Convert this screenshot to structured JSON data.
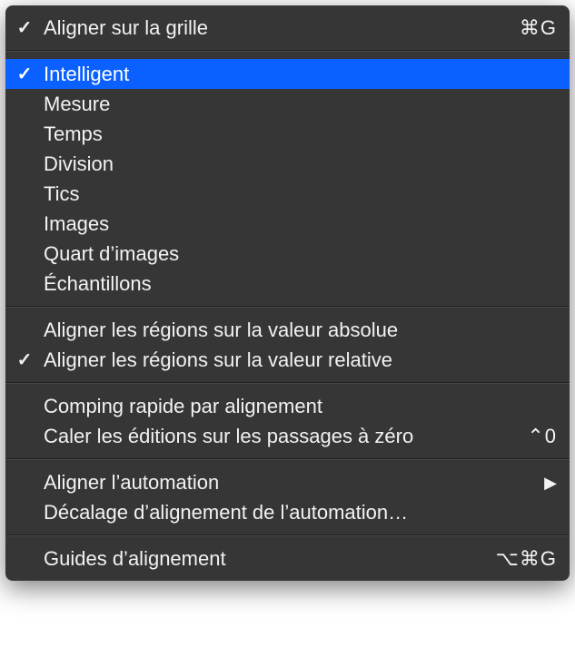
{
  "menu": {
    "groups": [
      {
        "items": [
          {
            "label": "Aligner sur la grille",
            "checked": true,
            "selected": false,
            "shortcut": "⌘G",
            "submenu": false,
            "name": "snap-to-grid"
          }
        ]
      },
      {
        "items": [
          {
            "label": "Intelligent",
            "checked": true,
            "selected": true,
            "shortcut": "",
            "submenu": false,
            "name": "snap-mode-smart"
          },
          {
            "label": "Mesure",
            "checked": false,
            "selected": false,
            "shortcut": "",
            "submenu": false,
            "name": "snap-mode-bar"
          },
          {
            "label": "Temps",
            "checked": false,
            "selected": false,
            "shortcut": "",
            "submenu": false,
            "name": "snap-mode-beat"
          },
          {
            "label": "Division",
            "checked": false,
            "selected": false,
            "shortcut": "",
            "submenu": false,
            "name": "snap-mode-division"
          },
          {
            "label": "Tics",
            "checked": false,
            "selected": false,
            "shortcut": "",
            "submenu": false,
            "name": "snap-mode-ticks"
          },
          {
            "label": "Images",
            "checked": false,
            "selected": false,
            "shortcut": "",
            "submenu": false,
            "name": "snap-mode-frames"
          },
          {
            "label": "Quart d’images",
            "checked": false,
            "selected": false,
            "shortcut": "",
            "submenu": false,
            "name": "snap-mode-quarter-frames"
          },
          {
            "label": "Échantillons",
            "checked": false,
            "selected": false,
            "shortcut": "",
            "submenu": false,
            "name": "snap-mode-samples"
          }
        ]
      },
      {
        "items": [
          {
            "label": "Aligner les régions sur la valeur absolue",
            "checked": false,
            "selected": false,
            "shortcut": "",
            "submenu": false,
            "name": "snap-regions-absolute"
          },
          {
            "label": "Aligner les régions sur la valeur relative",
            "checked": true,
            "selected": false,
            "shortcut": "",
            "submenu": false,
            "name": "snap-regions-relative"
          }
        ]
      },
      {
        "items": [
          {
            "label": "Comping rapide par alignement",
            "checked": false,
            "selected": false,
            "shortcut": "",
            "submenu": false,
            "name": "snap-quick-swipe-comping"
          },
          {
            "label": "Caler les éditions sur les passages à zéro",
            "checked": false,
            "selected": false,
            "shortcut": "⌃0",
            "submenu": false,
            "name": "snap-edits-to-zero-crossings"
          }
        ]
      },
      {
        "items": [
          {
            "label": "Aligner l’automation",
            "checked": false,
            "selected": false,
            "shortcut": "",
            "submenu": true,
            "name": "snap-automation-submenu"
          },
          {
            "label": "Décalage d’alignement de l’automation…",
            "checked": false,
            "selected": false,
            "shortcut": "",
            "submenu": false,
            "name": "automation-snap-offset"
          }
        ]
      },
      {
        "items": [
          {
            "label": "Guides d’alignement",
            "checked": false,
            "selected": false,
            "shortcut": "⌥⌘G",
            "submenu": false,
            "name": "alignment-guides"
          }
        ]
      }
    ]
  }
}
